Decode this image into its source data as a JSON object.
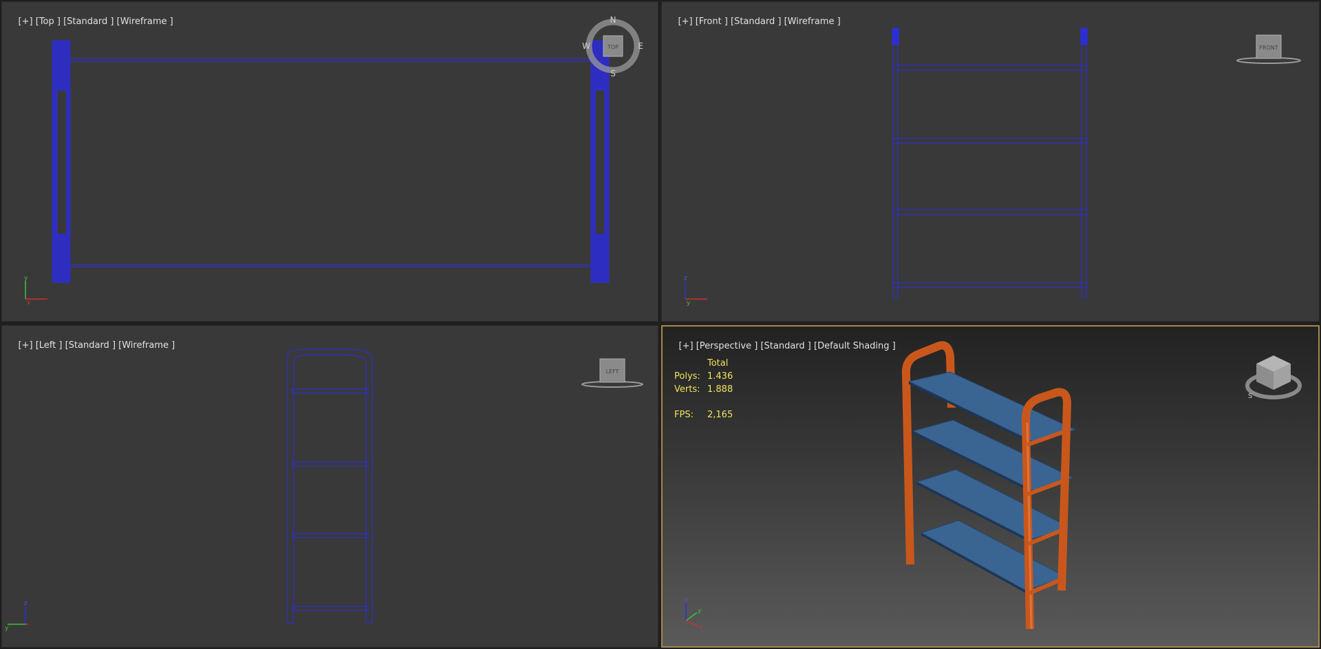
{
  "viewports": {
    "top": {
      "plus": "[+]",
      "view": "[Top ]",
      "standard": "[Standard ]",
      "mode": "[Wireframe ]"
    },
    "front": {
      "plus": "[+]",
      "view": "[Front ]",
      "standard": "[Standard ]",
      "mode": "[Wireframe ]"
    },
    "left": {
      "plus": "[+]",
      "view": "[Left ]",
      "standard": "[Standard ]",
      "mode": "[Wireframe ]"
    },
    "perspective": {
      "plus": "[+]",
      "view": "[Perspective ]",
      "standard": "[Standard ]",
      "mode": "[Default Shading ]"
    }
  },
  "compass": {
    "n": "N",
    "s": "S",
    "e": "E",
    "w": "W",
    "cube_face": "TOP"
  },
  "viewcube": {
    "front": "FRONT",
    "left": "LEFT"
  },
  "axis": {
    "x": "x",
    "y": "y",
    "z": "z"
  },
  "stats": {
    "header": "Total",
    "polys_label": "Polys:",
    "polys_value": "1.436",
    "verts_label": "Verts:",
    "verts_value": "1.888",
    "fps_label": "FPS:",
    "fps_value": "2,165"
  },
  "colors": {
    "viewport_bg": "#393939",
    "wire": "#2f2fd0",
    "frame_orange": "#c9571c",
    "shelf_blue": "#3a6593",
    "active_border": "#a4884a",
    "stats_text": "#f0e35a"
  }
}
